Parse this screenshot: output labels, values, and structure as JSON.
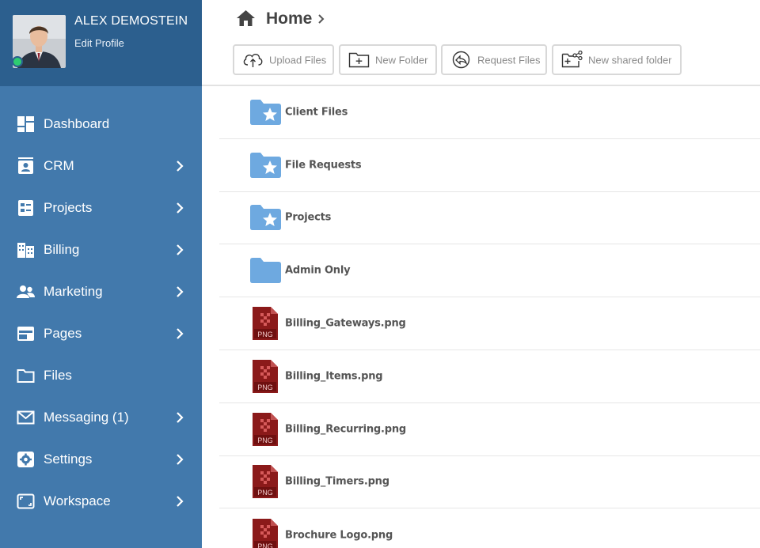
{
  "profile": {
    "name": "ALEX DEMOSTEIN",
    "edit_label": "Edit Profile",
    "status_color": "#2ecc71"
  },
  "sidebar": {
    "items": [
      {
        "label": "Dashboard",
        "icon": "dashboard-icon",
        "has_submenu": false
      },
      {
        "label": "CRM",
        "icon": "crm-contact-icon",
        "has_submenu": true
      },
      {
        "label": "Projects",
        "icon": "projects-checklist-icon",
        "has_submenu": true
      },
      {
        "label": "Billing",
        "icon": "billing-building-icon",
        "has_submenu": true
      },
      {
        "label": "Marketing",
        "icon": "marketing-users-icon",
        "has_submenu": true
      },
      {
        "label": "Pages",
        "icon": "pages-layout-icon",
        "has_submenu": true
      },
      {
        "label": "Files",
        "icon": "files-folder-icon",
        "has_submenu": false
      },
      {
        "label": "Messaging (1)",
        "icon": "messaging-envelope-icon",
        "has_submenu": true
      },
      {
        "label": "Settings",
        "icon": "settings-gear-icon",
        "has_submenu": true
      },
      {
        "label": "Workspace",
        "icon": "workspace-frame-icon",
        "has_submenu": true
      }
    ]
  },
  "header": {
    "title": "Home",
    "toolbar": {
      "upload_label": "Upload Files",
      "new_folder_label": "New Folder",
      "request_label": "Request Files",
      "shared_folder_label": "New shared folder"
    }
  },
  "files": [
    {
      "name": "Client Files",
      "type": "folder-starred"
    },
    {
      "name": "File Requests",
      "type": "folder-starred"
    },
    {
      "name": "Projects",
      "type": "folder-starred"
    },
    {
      "name": "Admin Only",
      "type": "folder"
    },
    {
      "name": "Billing_Gateways.png",
      "type": "png"
    },
    {
      "name": "Billing_Items.png",
      "type": "png"
    },
    {
      "name": "Billing_Recurring.png",
      "type": "png"
    },
    {
      "name": "Billing_Timers.png",
      "type": "png"
    },
    {
      "name": "Brochure Logo.png",
      "type": "png"
    }
  ],
  "file_type_badge": "PNG",
  "colors": {
    "sidebar": "#4279ac",
    "profile_bg": "#2c5f8e",
    "folder": "#6ea9e0",
    "png_icon": "#8b1a1a"
  }
}
